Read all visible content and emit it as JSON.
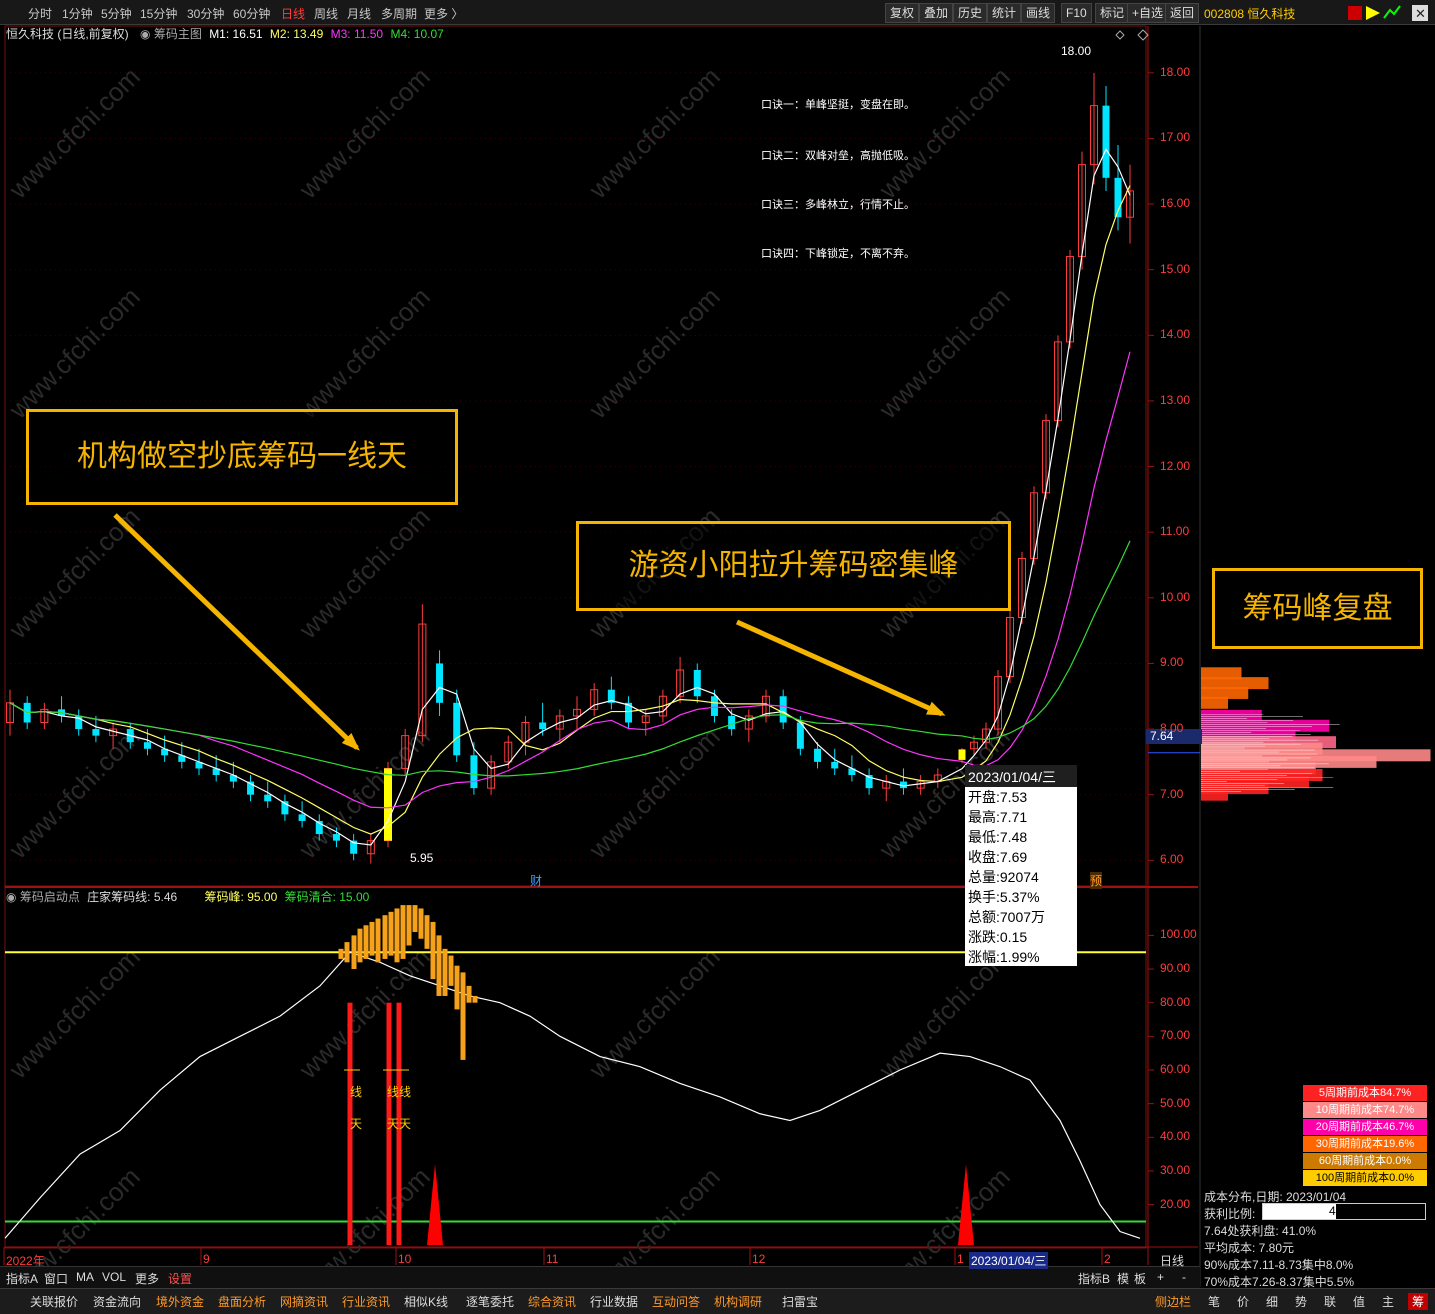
{
  "toolbar": {
    "periods": [
      "分时",
      "1分钟",
      "5分钟",
      "15分钟",
      "30分钟",
      "60分钟",
      "日线",
      "周线",
      "月线",
      "多周期",
      "更多 〉"
    ],
    "active": "日线",
    "right_buttons": [
      "复权",
      "叠加",
      "历史",
      "统计",
      "画线",
      "F10",
      "标记",
      "+自选",
      "返回"
    ],
    "code": "002808 恒久科技"
  },
  "main_header": {
    "name": "恒久科技 (日线,前复权)",
    "indicator": "筹码主图",
    "m1": "M1: 16.51",
    "m2": "M2: 13.49",
    "m3": "M3: 11.50",
    "m4": "M4: 10.07"
  },
  "sub_header": {
    "name": "筹码启动点",
    "line": "庄家筹码线: 5.46",
    "peak": "筹码峰: 95.00",
    "clear": "筹码清合: 15.00"
  },
  "mantras": [
    "口诀一：单峰坚挺，变盘在即。",
    "口诀二：双峰对垒，高抛低吸。",
    "口诀三：多峰林立，行情不止。",
    "口诀四：下峰锁定，不离不弃。"
  ],
  "callouts": {
    "left": "机构做空抄底筹码一线天",
    "middle": "游资小阳拉升筹码密集峰",
    "right": "筹码峰复盘"
  },
  "annotations": {
    "high": "18.00",
    "low": "5.95",
    "cai": "财",
    "yu": "预",
    "current_price": "7.64",
    "yixian": [
      "线",
      "天",
      "线线",
      "天天"
    ]
  },
  "tooltip": {
    "date": "2023/01/04/三",
    "rows": [
      "开盘:7.53",
      "最高:7.71",
      "最低:7.48",
      "收盘:7.69",
      "总量:92074",
      "换手:5.37%",
      "总额:7007万",
      "涨跌:0.15",
      "涨幅:1.99%"
    ]
  },
  "colors": {
    "up": "#ff3c3c",
    "down": "#00e5ff",
    "ma1": "#ffffff",
    "ma2": "#ffff66",
    "ma3": "#ff33ff",
    "ma4": "#33dd33",
    "peak_bar": "#f5a21a",
    "accent": "#f5b400"
  },
  "chart_data": {
    "type": "candlestick",
    "title": "恒久科技 (日线,前复权)",
    "price_axis": {
      "ticks": [
        6.0,
        7.0,
        8.0,
        9.0,
        10.0,
        11.0,
        12.0,
        13.0,
        14.0,
        15.0,
        16.0,
        17.0,
        18.0
      ]
    },
    "x_labels": [
      "2022年",
      "9",
      "10",
      "11",
      "12",
      "1",
      "2023/01/04/三",
      "2"
    ],
    "moving_averages": {
      "M1": 16.51,
      "M2": 13.49,
      "M3": 11.5,
      "M4": 10.07
    },
    "selected_bar": {
      "date": "2023/01/04",
      "open": 7.53,
      "high": 7.71,
      "low": 7.48,
      "close": 7.69,
      "volume": 92074,
      "turnover_pct": 5.37,
      "amount": "7007万",
      "change": 0.15,
      "change_pct": 1.99
    },
    "period_high": 18.0,
    "period_low": 5.95,
    "candles": [
      [
        8.1,
        8.6,
        7.9,
        8.4
      ],
      [
        8.4,
        8.5,
        8.0,
        8.1
      ],
      [
        8.1,
        8.4,
        8.0,
        8.3
      ],
      [
        8.3,
        8.5,
        8.1,
        8.2
      ],
      [
        8.2,
        8.3,
        7.9,
        8.0
      ],
      [
        8.0,
        8.2,
        7.8,
        7.9
      ],
      [
        7.9,
        8.1,
        7.7,
        8.0
      ],
      [
        8.0,
        8.1,
        7.7,
        7.8
      ],
      [
        7.8,
        8.0,
        7.6,
        7.7
      ],
      [
        7.7,
        7.9,
        7.5,
        7.6
      ],
      [
        7.6,
        7.8,
        7.4,
        7.5
      ],
      [
        7.5,
        7.7,
        7.3,
        7.4
      ],
      [
        7.4,
        7.6,
        7.2,
        7.3
      ],
      [
        7.3,
        7.5,
        7.1,
        7.2
      ],
      [
        7.2,
        7.3,
        6.9,
        7.0
      ],
      [
        7.0,
        7.2,
        6.8,
        6.9
      ],
      [
        6.9,
        7.0,
        6.6,
        6.7
      ],
      [
        6.7,
        6.9,
        6.5,
        6.6
      ],
      [
        6.6,
        6.7,
        6.3,
        6.4
      ],
      [
        6.4,
        6.5,
        6.2,
        6.3
      ],
      [
        6.3,
        6.4,
        6.0,
        6.1
      ],
      [
        6.1,
        6.4,
        5.95,
        6.3
      ],
      [
        6.3,
        7.5,
        6.2,
        7.4
      ],
      [
        7.4,
        8.0,
        7.3,
        7.9
      ],
      [
        7.9,
        9.9,
        7.8,
        9.6
      ],
      [
        9.0,
        9.2,
        8.2,
        8.4
      ],
      [
        8.4,
        8.6,
        7.5,
        7.6
      ],
      [
        7.6,
        7.8,
        7.0,
        7.1
      ],
      [
        7.1,
        7.6,
        7.0,
        7.5
      ],
      [
        7.5,
        7.9,
        7.4,
        7.8
      ],
      [
        7.8,
        8.2,
        7.6,
        8.1
      ],
      [
        8.1,
        8.4,
        7.9,
        8.0
      ],
      [
        8.0,
        8.3,
        7.8,
        8.2
      ],
      [
        8.2,
        8.5,
        8.0,
        8.3
      ],
      [
        8.3,
        8.7,
        8.2,
        8.6
      ],
      [
        8.6,
        8.8,
        8.3,
        8.4
      ],
      [
        8.4,
        8.5,
        8.0,
        8.1
      ],
      [
        8.1,
        8.3,
        7.9,
        8.2
      ],
      [
        8.2,
        8.6,
        8.1,
        8.5
      ],
      [
        8.5,
        9.1,
        8.4,
        8.9
      ],
      [
        8.9,
        9.0,
        8.4,
        8.5
      ],
      [
        8.5,
        8.6,
        8.1,
        8.2
      ],
      [
        8.2,
        8.3,
        7.9,
        8.0
      ],
      [
        8.0,
        8.3,
        7.8,
        8.2
      ],
      [
        8.2,
        8.6,
        8.1,
        8.5
      ],
      [
        8.5,
        8.6,
        8.0,
        8.1
      ],
      [
        8.1,
        8.2,
        7.6,
        7.7
      ],
      [
        7.7,
        7.8,
        7.4,
        7.5
      ],
      [
        7.5,
        7.7,
        7.3,
        7.4
      ],
      [
        7.4,
        7.6,
        7.2,
        7.3
      ],
      [
        7.3,
        7.4,
        7.0,
        7.1
      ],
      [
        7.1,
        7.3,
        6.9,
        7.2
      ],
      [
        7.2,
        7.4,
        7.0,
        7.1
      ],
      [
        7.1,
        7.3,
        7.0,
        7.2
      ],
      [
        7.2,
        7.4,
        7.1,
        7.3
      ],
      [
        7.53,
        7.71,
        7.48,
        7.69
      ],
      [
        7.7,
        7.9,
        7.6,
        7.8
      ],
      [
        7.8,
        8.1,
        7.7,
        8.0
      ],
      [
        8.0,
        8.9,
        7.9,
        8.8
      ],
      [
        8.8,
        9.8,
        8.7,
        9.7
      ],
      [
        9.7,
        10.7,
        9.6,
        10.6
      ],
      [
        10.6,
        11.7,
        10.5,
        11.6
      ],
      [
        11.6,
        12.8,
        11.5,
        12.7
      ],
      [
        12.7,
        14.0,
        12.6,
        13.9
      ],
      [
        13.9,
        15.3,
        13.8,
        15.2
      ],
      [
        15.2,
        16.8,
        15.0,
        16.6
      ],
      [
        16.6,
        18.0,
        16.3,
        17.5
      ],
      [
        17.5,
        17.8,
        16.2,
        16.4
      ],
      [
        16.4,
        16.9,
        15.6,
        15.8
      ],
      [
        15.8,
        16.6,
        15.4,
        16.2
      ]
    ],
    "sub_axis": {
      "ticks": [
        20,
        30,
        40,
        50,
        60,
        70,
        80,
        90,
        100
      ]
    },
    "sub_series": {
      "zhuangjia_line_last": 5.46,
      "peak_level": 95.0,
      "clear_level": 15.0
    },
    "cost_distribution": {
      "date": "2023/01/04",
      "profit_ratio": "45.1%",
      "rows": [
        "成本分布,日期: 2023/01/04",
        "获利比例:",
        "7.64处获利盘: 41.0%",
        "平均成本: 7.80元",
        "90%成本7.11-8.73集中8.0%",
        "70%成本7.26-8.37集中5.5%"
      ],
      "legend": [
        {
          "label": "5周期前成本84.7%",
          "color": "#ff2222"
        },
        {
          "label": "10周期前成本74.7%",
          "color": "#ff8888"
        },
        {
          "label": "20周期前成本46.7%",
          "color": "#ff00aa"
        },
        {
          "label": "30周期前成本19.6%",
          "color": "#ff6600"
        },
        {
          "label": "60周期前成本0.0%",
          "color": "#cc7a00"
        },
        {
          "label": "100周期前成本0.0%",
          "color": "#ffcc00"
        }
      ]
    }
  },
  "bottom_bar1": {
    "left": [
      "指标A",
      "窗口",
      "MA",
      "VOL",
      "更多",
      "设置"
    ],
    "right": [
      "指标B",
      "模",
      "板",
      "+",
      "-"
    ]
  },
  "bottom_bar2": {
    "items": [
      "关联报价",
      "资金流向",
      "境外资金",
      "盘面分析",
      "网摘资讯",
      "行业资讯",
      "相似K线",
      "逐笔委托",
      "综合资讯",
      "行业数据",
      "互动问答",
      "机构调研",
      "扫雷宝",
      "侧边栏"
    ],
    "right": [
      "笔",
      "价",
      "细",
      "势",
      "联",
      "值",
      "主",
      "筹"
    ]
  }
}
